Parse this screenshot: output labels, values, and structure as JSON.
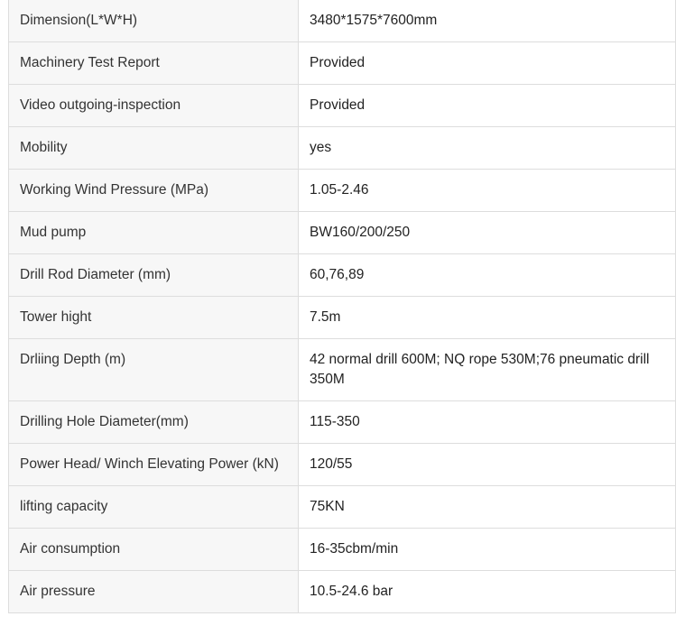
{
  "spec_table": {
    "rows": [
      {
        "label": "Dimension(L*W*H)",
        "value": "3480*1575*7600mm"
      },
      {
        "label": "Machinery Test Report",
        "value": "Provided"
      },
      {
        "label": "Video outgoing-inspection",
        "value": "Provided"
      },
      {
        "label": "Mobility",
        "value": "yes"
      },
      {
        "label": "Working Wind Pressure (MPa)",
        "value": "1.05-2.46"
      },
      {
        "label": "Mud pump",
        "value": "BW160/200/250"
      },
      {
        "label": "Drill Rod Diameter (mm)",
        "value": "60,76,89"
      },
      {
        "label": "Tower hight",
        "value": "7.5m"
      },
      {
        "label": "Drliing Depth (m)",
        "value": "42 normal drill 600M; NQ rope 530M;76 pneumatic drill 350M"
      },
      {
        "label": "Drilling Hole Diameter(mm)",
        "value": "115-350"
      },
      {
        "label": "Power Head/ Winch Elevating Power (kN)",
        "value": "120/55"
      },
      {
        "label": "lifting capacity",
        "value": "75KN"
      },
      {
        "label": "Air consumption",
        "value": "16-35cbm/min"
      },
      {
        "label": "Air pressure",
        "value": "10.5-24.6 bar"
      }
    ]
  }
}
